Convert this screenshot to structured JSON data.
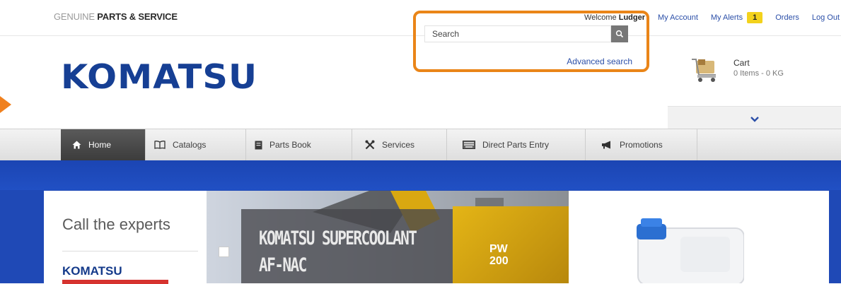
{
  "topbar": {
    "tagline_light": "GENUINE",
    "tagline_bold": "PARTS & SERVICE",
    "welcome_prefix": "Welcome",
    "user_name": "Ludger",
    "my_account": "My Account",
    "my_alerts": "My Alerts",
    "alerts_count": "1",
    "orders": "Orders",
    "logout": "Log Out"
  },
  "header": {
    "logo_text": "KOMATSU",
    "search_placeholder": "Search",
    "advanced_search": "Advanced search",
    "cart_title": "Cart",
    "cart_info": "0 Items - 0 KG"
  },
  "nav": {
    "items": [
      {
        "label": "Home",
        "icon": "home-icon"
      },
      {
        "label": "Catalogs",
        "icon": "book-icon"
      },
      {
        "label": "Parts Book",
        "icon": "document-icon"
      },
      {
        "label": "Services",
        "icon": "tools-icon"
      },
      {
        "label": "Direct Parts Entry",
        "icon": "keyboard-icon"
      },
      {
        "label": "Promotions",
        "icon": "megaphone-icon"
      }
    ]
  },
  "hero": {
    "experts_title": "Call the experts",
    "experts_brand": "KOMATSU",
    "promo_line1": "KOMATSU SUPERCOOLANT",
    "promo_line2": "AF-NAC",
    "machine_label_top": "PW",
    "machine_label_bottom": "200"
  },
  "colors": {
    "brand_blue": "#163f94",
    "highlight_orange": "#ea8518",
    "link_blue": "#2b4fa8",
    "alert_yellow": "#f3d21c",
    "hero_blue": "#1f49b6"
  }
}
